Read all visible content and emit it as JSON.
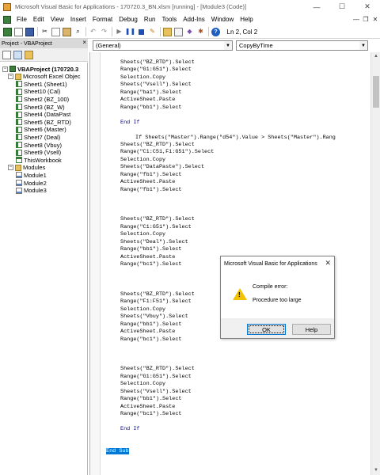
{
  "window": {
    "title": "Microsoft Visual Basic for Applications - 170720.3_BN.xlsm [running] - [Module3 (Code)]",
    "controls": [
      "—",
      "☐",
      "✕"
    ]
  },
  "menu": {
    "items": [
      "File",
      "Edit",
      "View",
      "Insert",
      "Format",
      "Debug",
      "Run",
      "Tools",
      "Add-Ins",
      "Window",
      "Help"
    ],
    "window_controls": [
      "—",
      "❐",
      "✕"
    ]
  },
  "toolbar": {
    "status": "Ln 2, Col 2"
  },
  "project": {
    "header": "Project - VBAProject",
    "close": "×",
    "tree": [
      {
        "label": "VBAProject (170720.3",
        "type": "proj",
        "level": 0,
        "expander": "−",
        "bold": true
      },
      {
        "label": "Microsoft Excel Objec",
        "type": "folder",
        "level": 1,
        "expander": "−",
        "bold": false
      },
      {
        "label": "Sheet1 (Sheet1)",
        "type": "sheet",
        "level": 2,
        "expander": "",
        "bold": false
      },
      {
        "label": "Sheet10 (Cal)",
        "type": "sheet",
        "level": 2,
        "expander": "",
        "bold": false
      },
      {
        "label": "Sheet2 (BZ_100)",
        "type": "sheet",
        "level": 2,
        "expander": "",
        "bold": false
      },
      {
        "label": "Sheet3 (BZ_W)",
        "type": "sheet",
        "level": 2,
        "expander": "",
        "bold": false
      },
      {
        "label": "Sheet4 (DataPast",
        "type": "sheet",
        "level": 2,
        "expander": "",
        "bold": false
      },
      {
        "label": "Sheet5 (BZ_RTD)",
        "type": "sheet",
        "level": 2,
        "expander": "",
        "bold": false
      },
      {
        "label": "Sheet6 (Master)",
        "type": "sheet",
        "level": 2,
        "expander": "",
        "bold": false
      },
      {
        "label": "Sheet7 (Deal)",
        "type": "sheet",
        "level": 2,
        "expander": "",
        "bold": false
      },
      {
        "label": "Sheet8 (Vbuy)",
        "type": "sheet",
        "level": 2,
        "expander": "",
        "bold": false
      },
      {
        "label": "Sheet9 (Vsell)",
        "type": "sheet",
        "level": 2,
        "expander": "",
        "bold": false
      },
      {
        "label": "ThisWorkbook",
        "type": "book",
        "level": 2,
        "expander": "",
        "bold": false
      },
      {
        "label": "Modules",
        "type": "folder",
        "level": 1,
        "expander": "−",
        "bold": false
      },
      {
        "label": "Module1",
        "type": "module",
        "level": 2,
        "expander": "",
        "bold": false
      },
      {
        "label": "Module2",
        "type": "module",
        "level": 2,
        "expander": "",
        "bold": false
      },
      {
        "label": "Module3",
        "type": "module",
        "level": 2,
        "expander": "",
        "bold": false
      }
    ]
  },
  "code": {
    "object_combo": "(General)",
    "proc_combo": "CopyByTime",
    "lines": [
      {
        "text": "Sheets(\"BZ_RTD\").Select",
        "indent": 0,
        "kw": false
      },
      {
        "text": "Range(\"G1:G51\").Select",
        "indent": 0,
        "kw": false
      },
      {
        "text": "Selection.Copy",
        "indent": 0,
        "kw": false
      },
      {
        "text": "Sheets(\"Vsell\").Select",
        "indent": 0,
        "kw": false
      },
      {
        "text": "Range(\"ba1\").Select",
        "indent": 0,
        "kw": false
      },
      {
        "text": "ActiveSheet.Paste",
        "indent": 0,
        "kw": false
      },
      {
        "text": "Range(\"bb1\").Select",
        "indent": 0,
        "kw": false
      },
      {
        "text": "",
        "indent": 0,
        "kw": false
      },
      {
        "text": "End If",
        "indent": 0,
        "kw": true
      },
      {
        "text": "",
        "indent": 0,
        "kw": false
      },
      {
        "text": "If Sheets(\"Master\").Range(\"d54\").Value > Sheets(\"Master\").Rang",
        "indent": 1,
        "kw": false
      },
      {
        "text": "Sheets(\"BZ_RTD\").Select",
        "indent": 0,
        "kw": false
      },
      {
        "text": "Range(\"C1:C51,F1:G51\").Select",
        "indent": 0,
        "kw": false
      },
      {
        "text": "Selection.Copy",
        "indent": 0,
        "kw": false
      },
      {
        "text": "Sheets(\"DataPaste\").Select",
        "indent": 0,
        "kw": false
      },
      {
        "text": "Range(\"fb1\").Select",
        "indent": 0,
        "kw": false
      },
      {
        "text": "ActiveSheet.Paste",
        "indent": 0,
        "kw": false
      },
      {
        "text": "Range(\"fb1\").Select",
        "indent": 0,
        "kw": false
      },
      {
        "text": "",
        "indent": 0,
        "kw": false
      },
      {
        "text": "",
        "indent": 0,
        "kw": false
      },
      {
        "text": "",
        "indent": 0,
        "kw": false
      },
      {
        "text": "Sheets(\"BZ_RTD\").Select",
        "indent": 0,
        "kw": false
      },
      {
        "text": "Range(\"C1:G51\").Select",
        "indent": 0,
        "kw": false
      },
      {
        "text": "Selection.Copy",
        "indent": 0,
        "kw": false
      },
      {
        "text": "Sheets(\"Deal\").Select",
        "indent": 0,
        "kw": false
      },
      {
        "text": "Range(\"bb1\").Select",
        "indent": 0,
        "kw": false
      },
      {
        "text": "ActiveSheet.Paste",
        "indent": 0,
        "kw": false
      },
      {
        "text": "Range(\"bc1\").Select",
        "indent": 0,
        "kw": false
      },
      {
        "text": "",
        "indent": 0,
        "kw": false
      },
      {
        "text": "",
        "indent": 0,
        "kw": false
      },
      {
        "text": "",
        "indent": 0,
        "kw": false
      },
      {
        "text": "Sheets(\"BZ_RTD\").Select",
        "indent": 0,
        "kw": false
      },
      {
        "text": "Range(\"F1:F51\").Select",
        "indent": 0,
        "kw": false
      },
      {
        "text": "Selection.Copy",
        "indent": 0,
        "kw": false
      },
      {
        "text": "Sheets(\"Vbuy\").Select",
        "indent": 0,
        "kw": false
      },
      {
        "text": "Range(\"bb1\").Select",
        "indent": 0,
        "kw": false
      },
      {
        "text": "ActiveSheet.Paste",
        "indent": 0,
        "kw": false
      },
      {
        "text": "Range(\"bc1\").Select",
        "indent": 0,
        "kw": false
      },
      {
        "text": "",
        "indent": 0,
        "kw": false
      },
      {
        "text": "",
        "indent": 0,
        "kw": false
      },
      {
        "text": "",
        "indent": 0,
        "kw": false
      },
      {
        "text": "Sheets(\"BZ_RTD\").Select",
        "indent": 0,
        "kw": false
      },
      {
        "text": "Range(\"G1:G51\").Select",
        "indent": 0,
        "kw": false
      },
      {
        "text": "Selection.Copy",
        "indent": 0,
        "kw": false
      },
      {
        "text": "Sheets(\"Vsell\").Select",
        "indent": 0,
        "kw": false
      },
      {
        "text": "Range(\"bb1\").Select",
        "indent": 0,
        "kw": false
      },
      {
        "text": "ActiveSheet.Paste",
        "indent": 0,
        "kw": false
      },
      {
        "text": "Range(\"bc1\").Select",
        "indent": 0,
        "kw": false
      },
      {
        "text": "",
        "indent": 0,
        "kw": false
      },
      {
        "text": "End If",
        "indent": 0,
        "kw": true
      },
      {
        "text": "",
        "indent": 0,
        "kw": false
      },
      {
        "text": "",
        "indent": 0,
        "kw": false
      },
      {
        "text": "End Sub",
        "indent": -1,
        "kw": true,
        "selected": true
      }
    ]
  },
  "dialog": {
    "title": "Microsoft Visual Basic for Applications",
    "close": "✕",
    "message_line1": "Compile error:",
    "message_line2": "Procedure too large",
    "ok_label": "OK",
    "help_label": "Help"
  },
  "colors": {
    "selection": "#0078d7",
    "warning": "#f2c200",
    "keyword": "#00008b"
  }
}
